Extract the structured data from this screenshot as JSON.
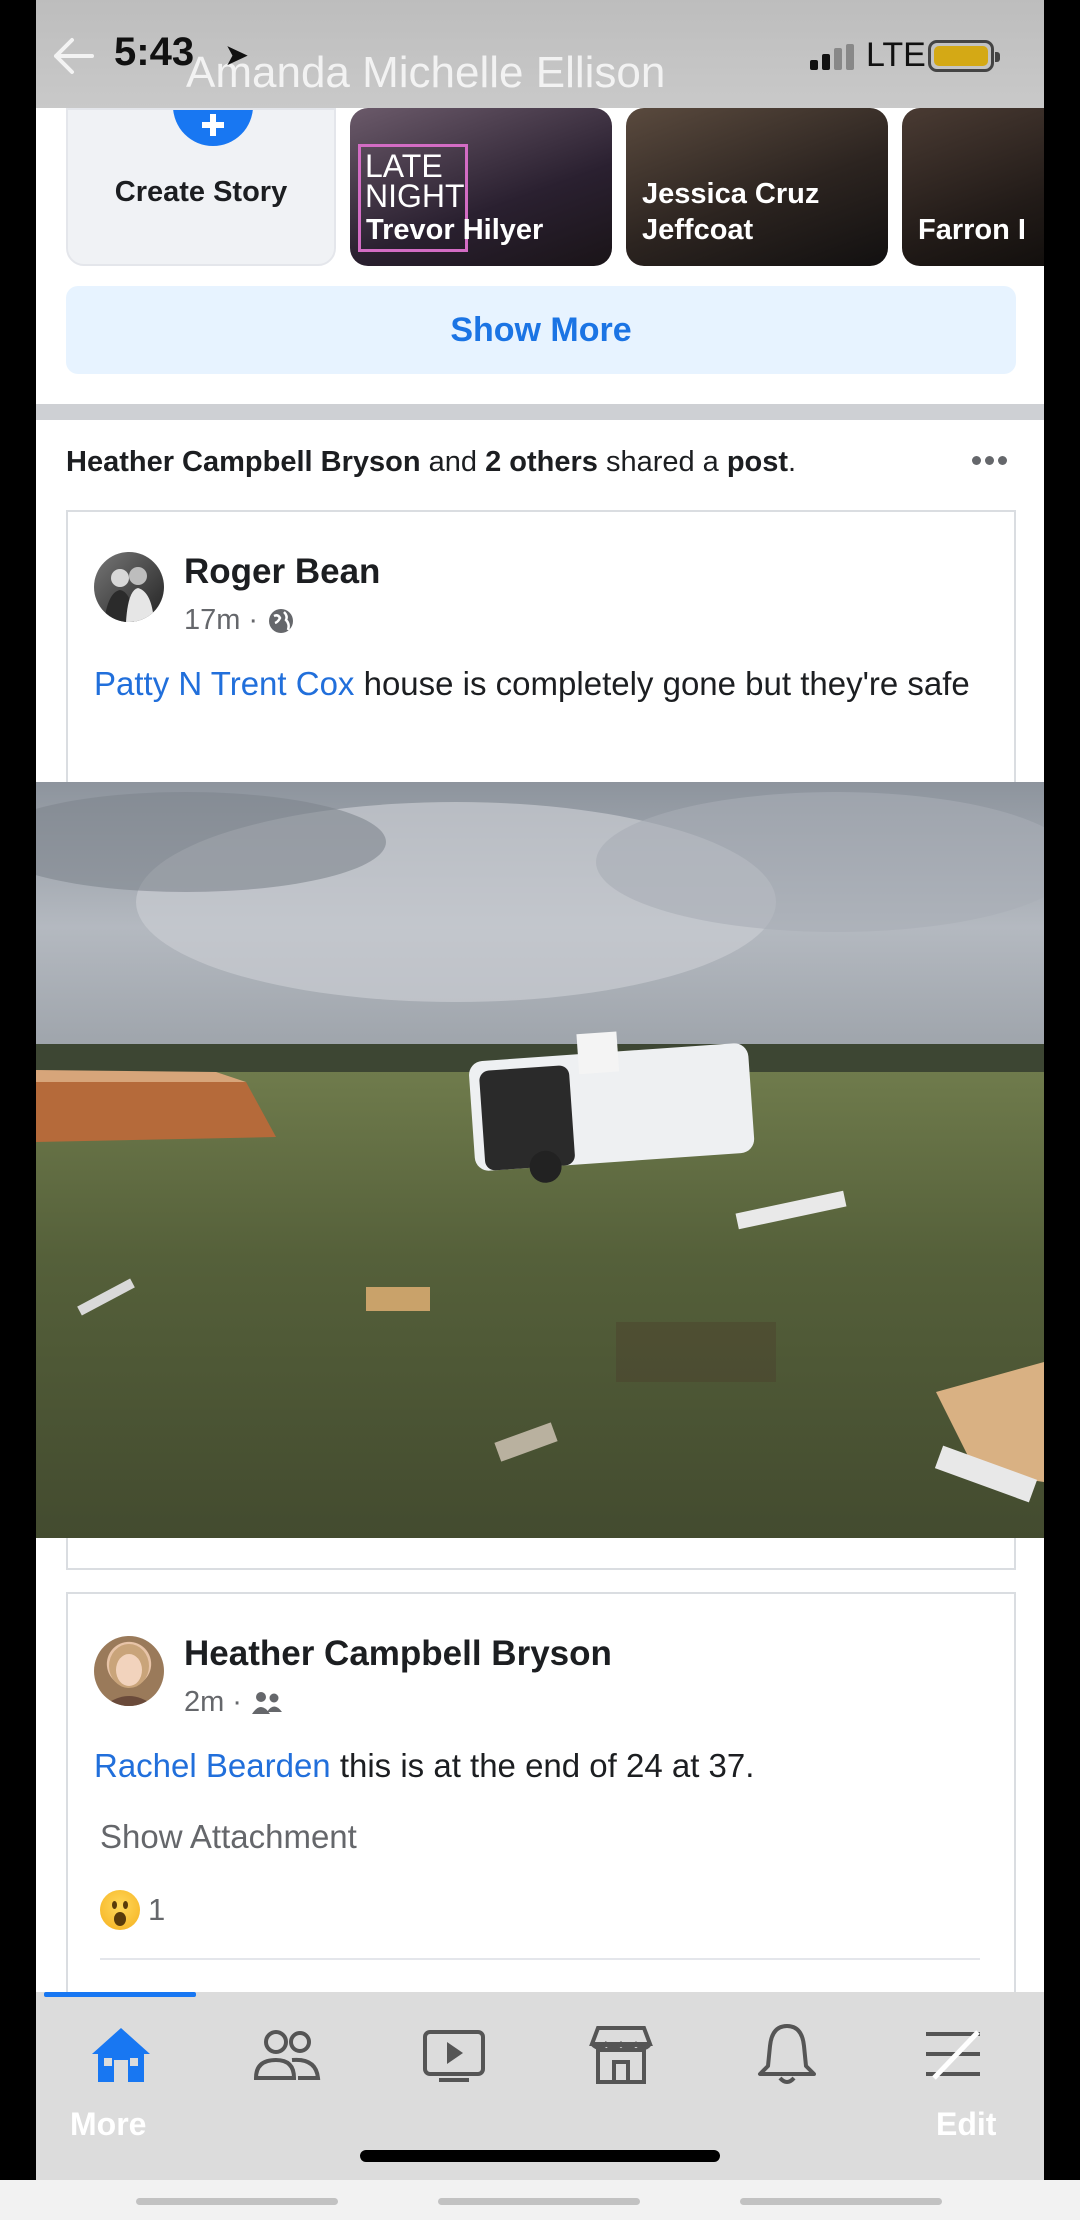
{
  "status_bar": {
    "time": "5:43",
    "network": "LTE"
  },
  "header": {
    "title": "Amanda Michelle Ellison"
  },
  "stories": {
    "create_label": "Create Story",
    "items": [
      {
        "name": "Trevor Hilyer",
        "badge": "LATE NIGHT"
      },
      {
        "name": "Jessica Cruz Jeffcoat"
      },
      {
        "name": "Farron I"
      }
    ],
    "show_more": "Show More"
  },
  "shared_notice": {
    "actor": "Heather Campbell Bryson",
    "connector": "and",
    "others": "2 others",
    "verb": "shared a",
    "object": "post",
    "end": "."
  },
  "post1": {
    "author": "Roger Bean",
    "time": "17m",
    "audience_icon": "globe-icon",
    "mention": "Patty N Trent Cox",
    "text": " house is completely gone but they're safe"
  },
  "post2": {
    "author": "Heather Campbell Bryson",
    "time": "2m",
    "audience_icon": "friends-icon",
    "mention": "Rachel Bearden",
    "text": " this is at the end of 24 at 37.",
    "show_attachment": "Show Attachment",
    "reaction_count": "1",
    "reaction_icon": "wow-reaction-icon"
  },
  "tabbar": {
    "tabs": [
      {
        "icon": "home-icon",
        "active": true
      },
      {
        "icon": "friends-icon"
      },
      {
        "icon": "watch-icon"
      },
      {
        "icon": "marketplace-icon"
      },
      {
        "icon": "bell-icon"
      },
      {
        "icon": "menu-icon"
      }
    ],
    "left_label": "More",
    "right_label": "Edit"
  },
  "colors": {
    "brand_blue": "#1877f2",
    "link_blue": "#216fdb",
    "text": "#1c1e21",
    "muted": "#65676b"
  }
}
